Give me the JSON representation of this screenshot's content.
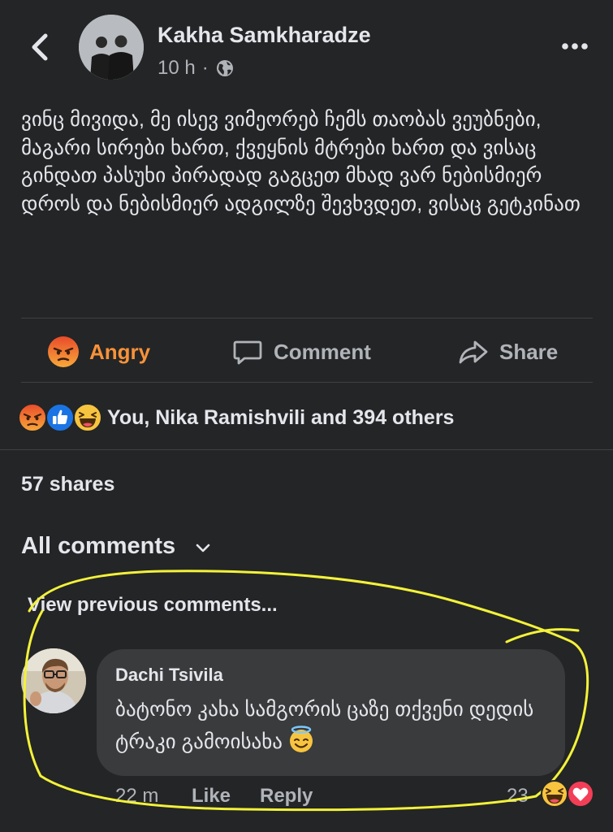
{
  "header": {
    "author": "Kakha Samkharadze",
    "time": "10 h",
    "separator": "·",
    "back_icon": "chevron-left-icon",
    "privacy_icon": "globe-icon",
    "more_icon": "more-horizontal-icon"
  },
  "post": {
    "text": "ვინც მივიდა, მე ისევ ვიმეორებ ჩემს თაობას ვეუბნები, მაგარი სირები ხართ, ქვეყნის მტრები ხართ და ვისაც გინდათ პასუხი პირადად გაგცეთ მხად ვარ ნებისმიერ დროს და ნებისმიერ ადგილზე შევხვდეთ, ვისაც გეტკინათ"
  },
  "actions": {
    "angry_label": "Angry",
    "comment_label": "Comment",
    "share_label": "Share",
    "angry_color": "#f7923a"
  },
  "reactions": {
    "icons": [
      "angry-icon",
      "like-icon",
      "haha-icon"
    ],
    "summary": "You, Nika Ramishvili and 394 others"
  },
  "shares": "57 shares",
  "comments": {
    "filter_label": "All comments",
    "view_previous": "View previous comments...",
    "items": [
      {
        "name": "Dachi Tsivila",
        "text": "ბატონო კახა სამგორის ცაზე თქვენი დედის ტრაკი გამოისახა",
        "emoji": "smiling-face-with-halo-icon",
        "time": "22 m",
        "like_label": "Like",
        "reply_label": "Reply",
        "reaction_count": "23",
        "reaction_icons": [
          "haha-icon",
          "love-icon"
        ]
      }
    ]
  },
  "annotation": {
    "color": "#f2f23a"
  }
}
